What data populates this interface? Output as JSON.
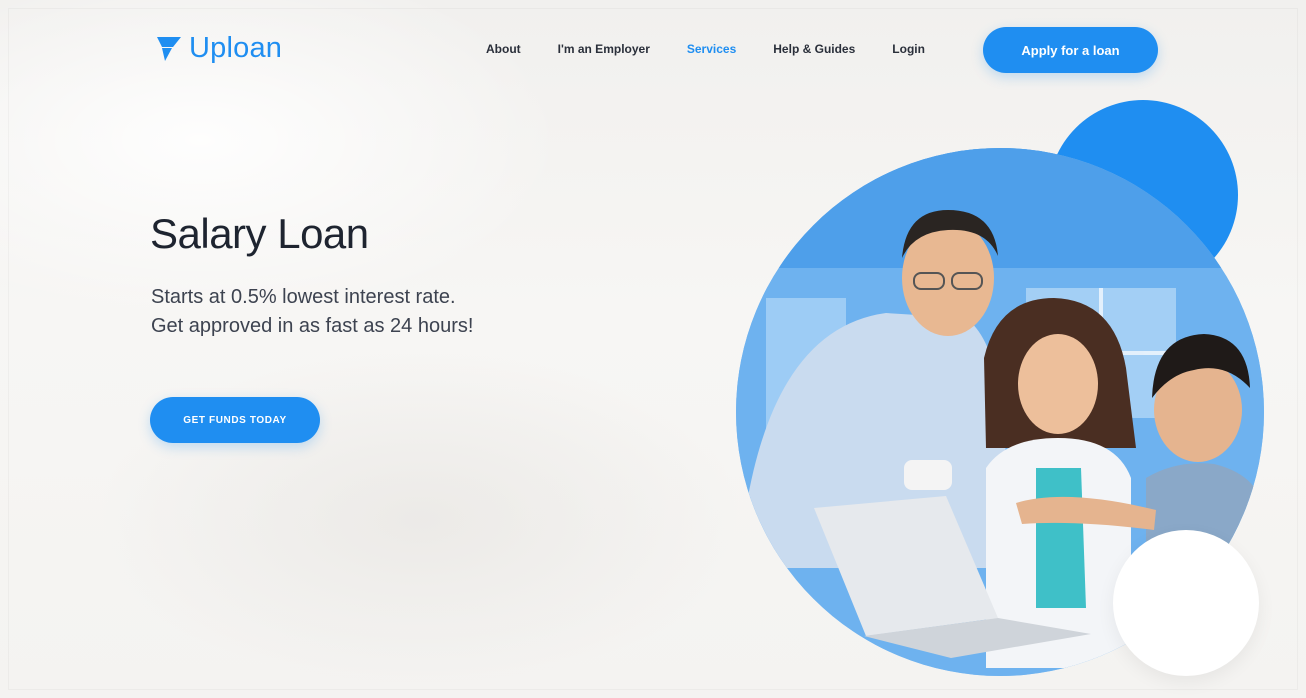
{
  "brand": {
    "name": "Uploan",
    "logo_icon": "uploan-arrow-icon",
    "color": "#1f8ef1"
  },
  "nav": {
    "items": [
      {
        "label": "About"
      },
      {
        "label": "I'm an Employer"
      },
      {
        "label": "Services",
        "active": true
      },
      {
        "label": "Help & Guides"
      },
      {
        "label": "Login"
      }
    ],
    "apply_button": "Apply for a loan"
  },
  "hero": {
    "title": "Salary Loan",
    "subtitle_lines": [
      "Starts at 0.5% lowest interest rate.",
      "Get approved in as fast as 24 hours!"
    ],
    "cta": "GET FUNDS TODAY",
    "image": "family-with-laptop-photo"
  },
  "colors": {
    "accent": "#1f8ef1",
    "text_dark": "#1e2430",
    "background": "#f4f3f1"
  }
}
